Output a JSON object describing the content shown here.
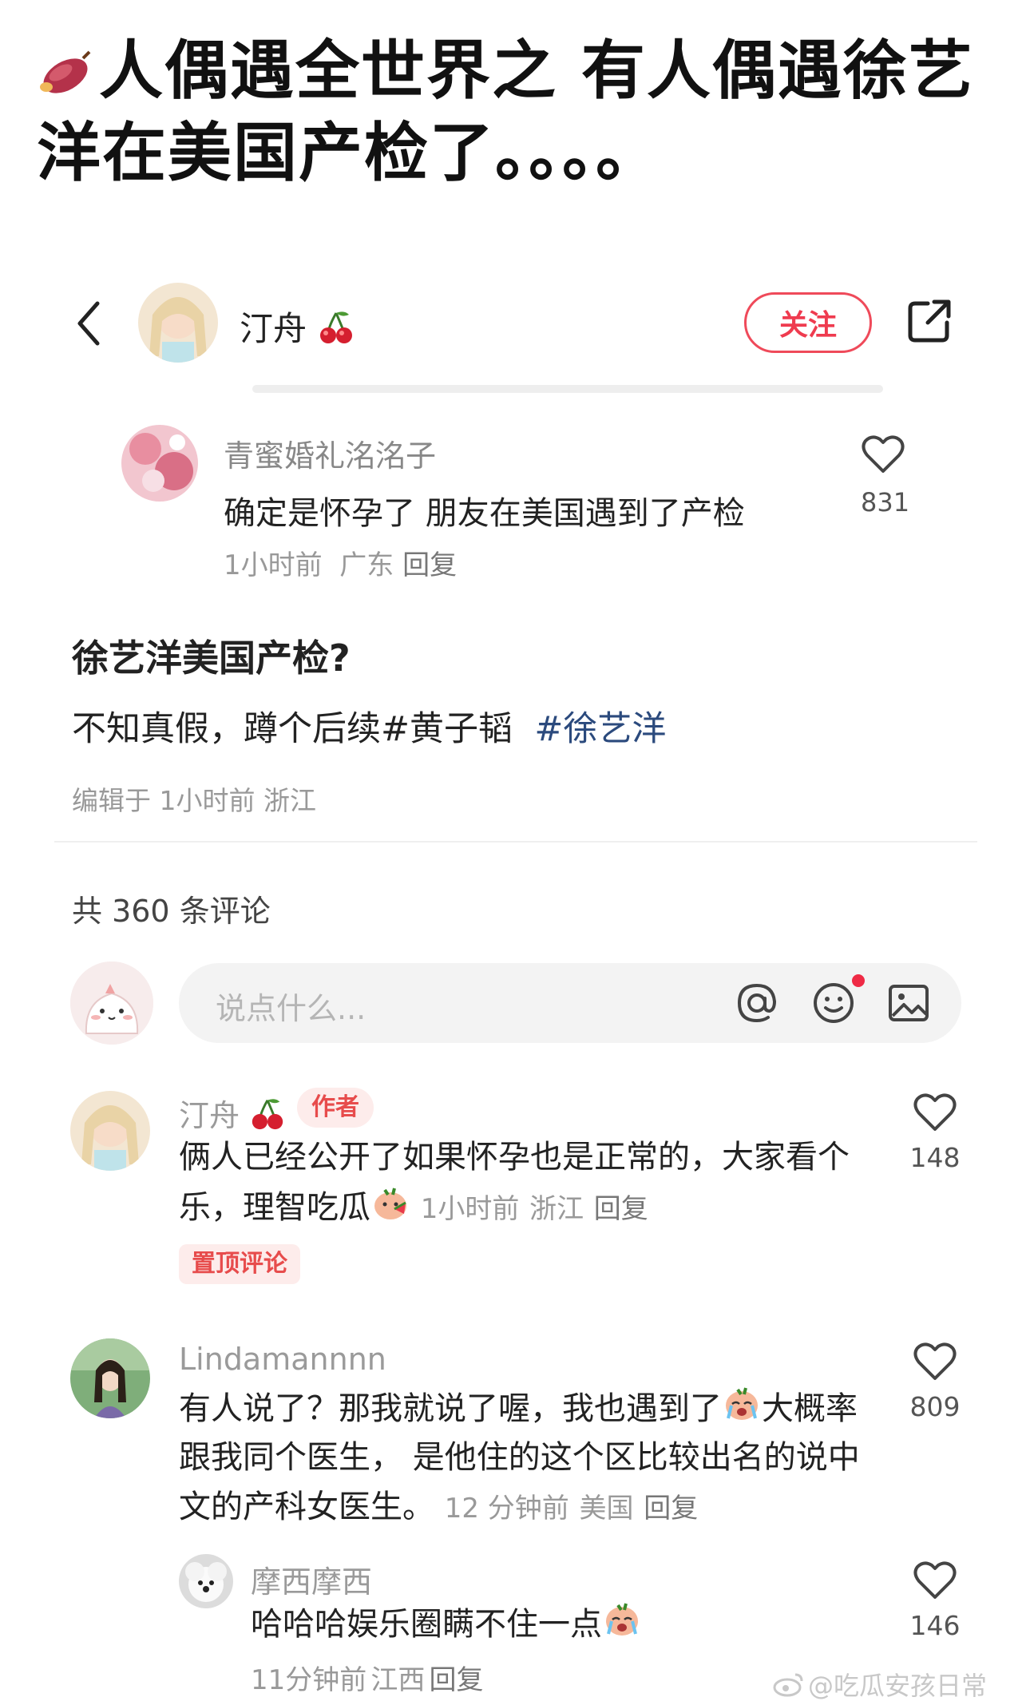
{
  "headline": "人偶遇全世界之 有人偶遇徐艺洋在美国产检了。。。。",
  "header": {
    "username": "汀舟",
    "follow_label": "关注"
  },
  "quoted_comment": {
    "username": "青蜜婚礼洺洺子",
    "text": "确定是怀孕了 朋友在美国遇到了产检",
    "time": "1小时前",
    "location": "广东",
    "reply_label": "回复",
    "likes": "831"
  },
  "post": {
    "title": "徐艺洋美国产检?",
    "body_text": "不知真假，蹲个后续#黄子韬",
    "body_tag": "#徐艺洋",
    "meta": "编辑于 1小时前 浙江"
  },
  "comments_header": "共 360 条评论",
  "input": {
    "placeholder": "说点什么..."
  },
  "comments": [
    {
      "username": "汀舟",
      "badge": "作者",
      "text_line1": "俩人已经公开了如果怀孕也是正常的，大家看个",
      "text_line2": "乐，理智吃瓜",
      "time": "1小时前",
      "location": "浙江",
      "reply_label": "回复",
      "pin_label": "置顶评论",
      "likes": "148"
    },
    {
      "username": "Lindamannnn",
      "text_line1a": "有人说了？那我就说了喔，我也遇到了",
      "text_line1b": "大概率",
      "text_line2": "跟我同个医生， 是他住的这个区比较出名的说中",
      "text_line3": "文的产科女医生。",
      "time": "12 分钟前",
      "location": "美国",
      "reply_label": "回复",
      "likes": "809"
    },
    {
      "username": "摩西摩西",
      "text": "哈哈哈娱乐圈瞒不住一点",
      "time": "11分钟前",
      "location": "江西",
      "reply_label": "回复",
      "likes": "146"
    }
  ],
  "watermark": "@吃瓜安孩日常",
  "colors": {
    "accent_red": "#ef3b4f",
    "tag_blue": "#2b4a7d",
    "muted_gray": "#999999"
  }
}
